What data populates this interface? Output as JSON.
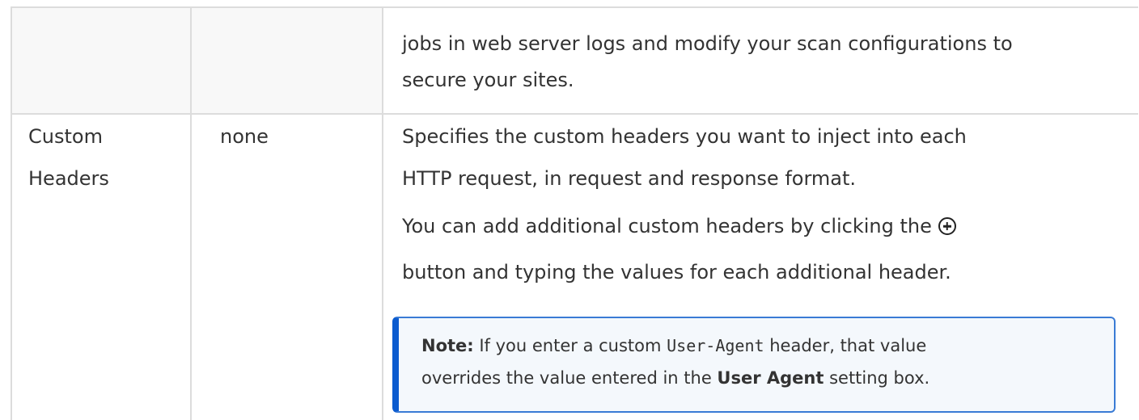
{
  "table": {
    "row_top": {
      "description_line1": "jobs in web server logs and modify your scan configurations to",
      "description_line2": "secure your sites."
    },
    "row_custom_headers": {
      "setting_line1": "Custom",
      "setting_line2": "Headers",
      "default_value": "none",
      "description_line1": "Specifies the custom headers you want to inject into each",
      "description_line2": "HTTP request, in request and response format.",
      "description_line3": "You can add additional custom headers by clicking the",
      "description_line4": "button and typing the values for each additional header.",
      "note": {
        "label": "Note:",
        "text_a": " If you enter a custom ",
        "code": "User-Agent",
        "text_b": " header, that value",
        "text_c": "overrides the value entered in the ",
        "bold_term": "User Agent",
        "text_d": " setting box."
      }
    }
  },
  "icons": {
    "add_icon": "plus-circle-icon"
  },
  "colors": {
    "note_accent": "#0b5bcf",
    "note_border": "#3a7bd5",
    "note_background": "#f4f8fc",
    "grid_line": "#dcdcdc",
    "shaded_cell": "#f8f8f8"
  }
}
